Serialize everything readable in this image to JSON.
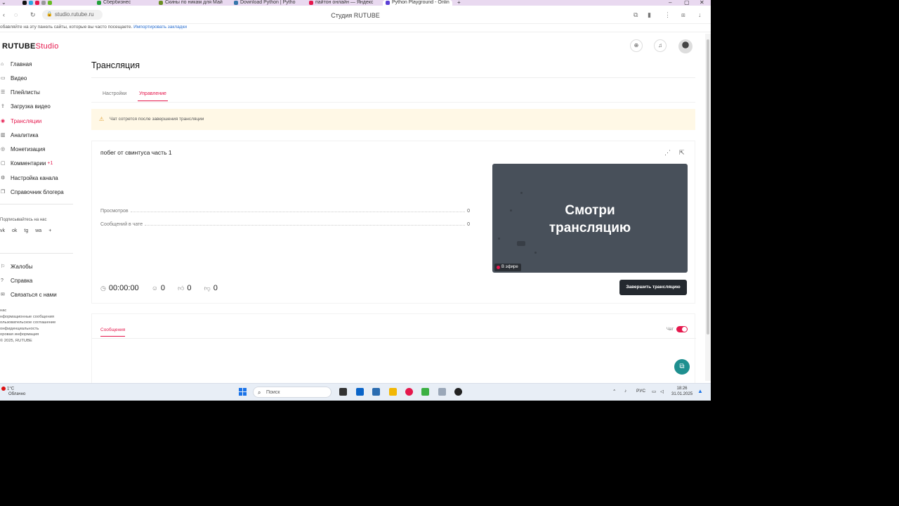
{
  "browser": {
    "tabs": [
      {
        "label": "Сбербизнес",
        "color": "#21a038"
      },
      {
        "label": "Скины по никам для Май",
        "color": "#6b8e23"
      },
      {
        "label": "Download Python | Pytho",
        "color": "#3776ab"
      },
      {
        "label": "пайтон онлайн — Яндекс",
        "color": "#e5174c"
      },
      {
        "label": "Python Playground - Onlin",
        "color": "#5b3fd6"
      }
    ],
    "url": "studio.rutube.ru",
    "page_title": "Студия RUTUBE",
    "bookmarks_hint": "обавляйте на эту панель сайты, которые вы часто посещаете.",
    "bookmarks_link": "Импортировать закладки"
  },
  "app": {
    "logo_main": "RUTUBE",
    "logo_studio": "Studio"
  },
  "sidebar": {
    "items": [
      {
        "label": "Главная",
        "icon": "home-icon",
        "glyph": "⌂"
      },
      {
        "label": "Видео",
        "icon": "video-icon",
        "glyph": "▭"
      },
      {
        "label": "Плейлисты",
        "icon": "playlist-icon",
        "glyph": "☰"
      },
      {
        "label": "Загрузка видео",
        "icon": "upload-icon",
        "glyph": "⇪"
      },
      {
        "label": "Трансляции",
        "icon": "broadcast-icon",
        "glyph": "◉",
        "active": true
      },
      {
        "label": "Аналитика",
        "icon": "analytics-icon",
        "glyph": "▥"
      },
      {
        "label": "Монетизация",
        "icon": "money-icon",
        "glyph": "◎"
      },
      {
        "label": "Комментарии",
        "icon": "comments-icon",
        "glyph": "▢",
        "badge": "+1"
      },
      {
        "label": "Настройка канала",
        "icon": "gear-icon",
        "glyph": "⚙"
      },
      {
        "label": "Справочник блогера",
        "icon": "book-icon",
        "glyph": "❐"
      }
    ],
    "subscribe_label": "Подписывайтесь на нас",
    "socials": [
      "vk",
      "ok",
      "tg",
      "wa",
      "+"
    ],
    "bottom_items": [
      {
        "label": "Жалобы",
        "icon": "flag-icon",
        "glyph": "⚐"
      },
      {
        "label": "Справка",
        "icon": "help-icon",
        "glyph": "?"
      },
      {
        "label": "Связаться с нами",
        "icon": "chat-icon",
        "glyph": "✉"
      }
    ],
    "footer": [
      "нас",
      "нформационные сообщения",
      "ользовательское соглашение",
      "онфиденциальность",
      "оровая информация",
      "© 2025, RUTUBE"
    ]
  },
  "page": {
    "title": "Трансляция",
    "tabs": [
      "Настройки",
      "Управление"
    ],
    "active_tab": 1,
    "warning": "Чат сотрется после завершения трансляции"
  },
  "stream": {
    "title": "побег от свинтуса часть 1",
    "metrics": [
      {
        "label": "Просмотров",
        "value": "0"
      },
      {
        "label": "Сообщений в чате",
        "value": "0"
      }
    ],
    "preview_line1": "Смотри",
    "preview_line2": "трансляцию",
    "live_badge": "В эфире",
    "duration": "00:00:00",
    "viewers": "0",
    "likes": "0",
    "dislikes": "0",
    "end_button": "Завершить трансляцию"
  },
  "messages": {
    "tab": "Сообщения",
    "chat_label": "Чат",
    "chat_enabled": true
  },
  "taskbar": {
    "temp": "1°C",
    "weather": "Облачно",
    "search_placeholder": "Поиск",
    "lang": "РУС",
    "time": "18:26",
    "date": "31.01.2025"
  },
  "colors": {
    "accent": "#e5174c",
    "dark_button": "#24292f",
    "warning_bg": "#fff8e6"
  }
}
